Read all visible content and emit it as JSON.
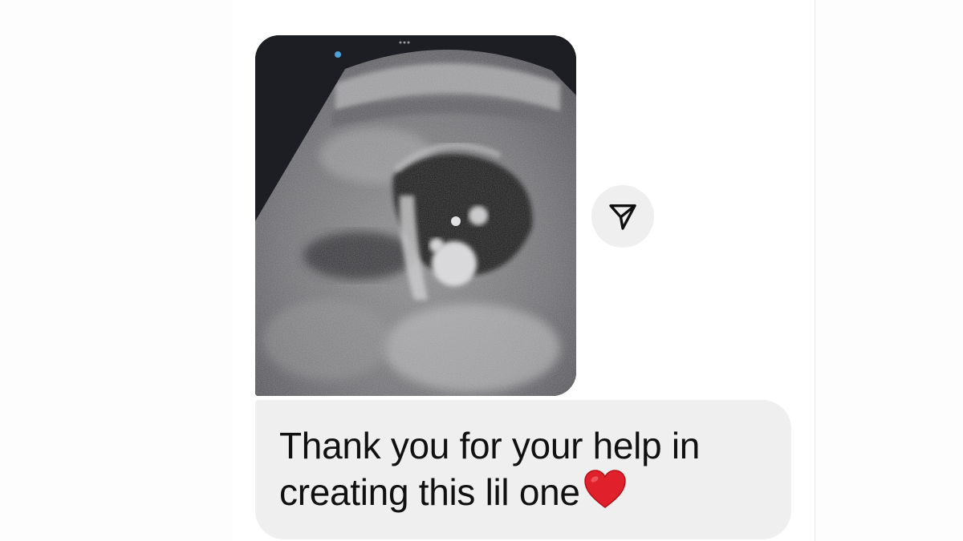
{
  "conversation": {
    "attachment": {
      "type": "photo",
      "subject_icon": "ultrasound-scan-image"
    },
    "share": {
      "icon": "send-arrow-icon"
    },
    "message": {
      "text": "Thank you for your help in creating this lil one",
      "emoji_icon": "red-heart-icon",
      "bubble_color": "#efefef",
      "heart_color": "#e0202a"
    }
  }
}
